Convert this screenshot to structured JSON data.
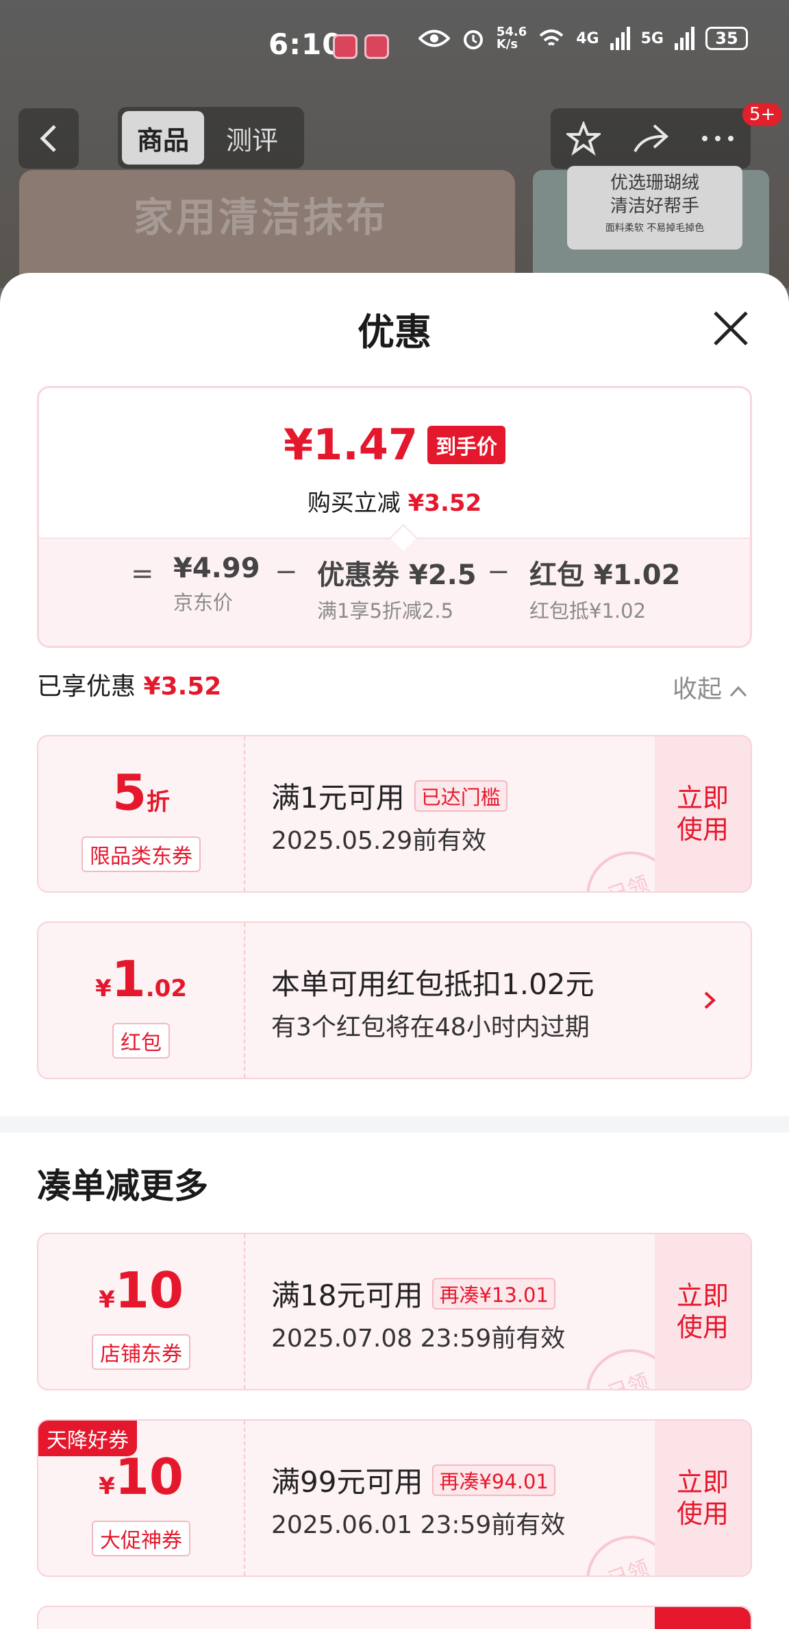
{
  "status": {
    "time": "6:10",
    "speed": "54.6\nK/s",
    "battery": "35",
    "net1": "4G",
    "net2": "5G"
  },
  "nav": {
    "tab_active": "商品",
    "tab_other": "测评",
    "badge": "5+"
  },
  "background": {
    "banner_title": "家用清洁抹布",
    "thumb_line1": "优选珊瑚绒",
    "thumb_line2": "清洁好帮手",
    "thumb_small": "面料柔软 不易掉毛掉色"
  },
  "sheet": {
    "title": "优惠"
  },
  "price": {
    "final": "¥1.47",
    "final_tag": "到手价",
    "saved_label": "购买立减",
    "saved_value": "¥3.52",
    "eq": "=",
    "jd_value": "¥4.99",
    "jd_label": "京东价",
    "minus": "−",
    "coupon_value": "优惠券 ¥2.5",
    "coupon_label": "满1享5折减2.5",
    "hongbao_value": "红包 ¥1.02",
    "hongbao_label": "红包抵¥1.02"
  },
  "enjoyed": {
    "label": "已享优惠",
    "value": "¥3.52",
    "collapse": "收起"
  },
  "coupons": [
    {
      "big": "5",
      "small": "折",
      "type": "限品类东券",
      "title": "满1元可用",
      "pill": "已达门槛",
      "date": "2025.05.29前有效",
      "button": "立即\n使用",
      "stamp": "已领"
    },
    {
      "prefix": "¥",
      "big": "1",
      "small": ".02",
      "type": "红包",
      "title": "本单可用红包抵扣1.02元",
      "date": "有3个红包将在48小时内过期"
    }
  ],
  "more": {
    "title": "凑单减更多",
    "coupons": [
      {
        "prefix": "¥",
        "big": "10",
        "type": "店铺东券",
        "title": "满18元可用",
        "pill": "再凑¥13.01",
        "date": "2025.07.08 23:59前有效",
        "button": "立即\n使用",
        "stamp": "已领"
      },
      {
        "ribbon": "天降好券",
        "prefix": "¥",
        "big": "10",
        "type": "大促神券",
        "title": "满99元可用",
        "pill": "再凑¥94.01",
        "date": "2025.06.01 23:59前有效",
        "button": "立即\n使用",
        "stamp": "已领"
      }
    ]
  },
  "colors": {
    "accent": "#e5172c",
    "coupon_bg": "#fdf2f4",
    "border": "#f7d2d8"
  }
}
